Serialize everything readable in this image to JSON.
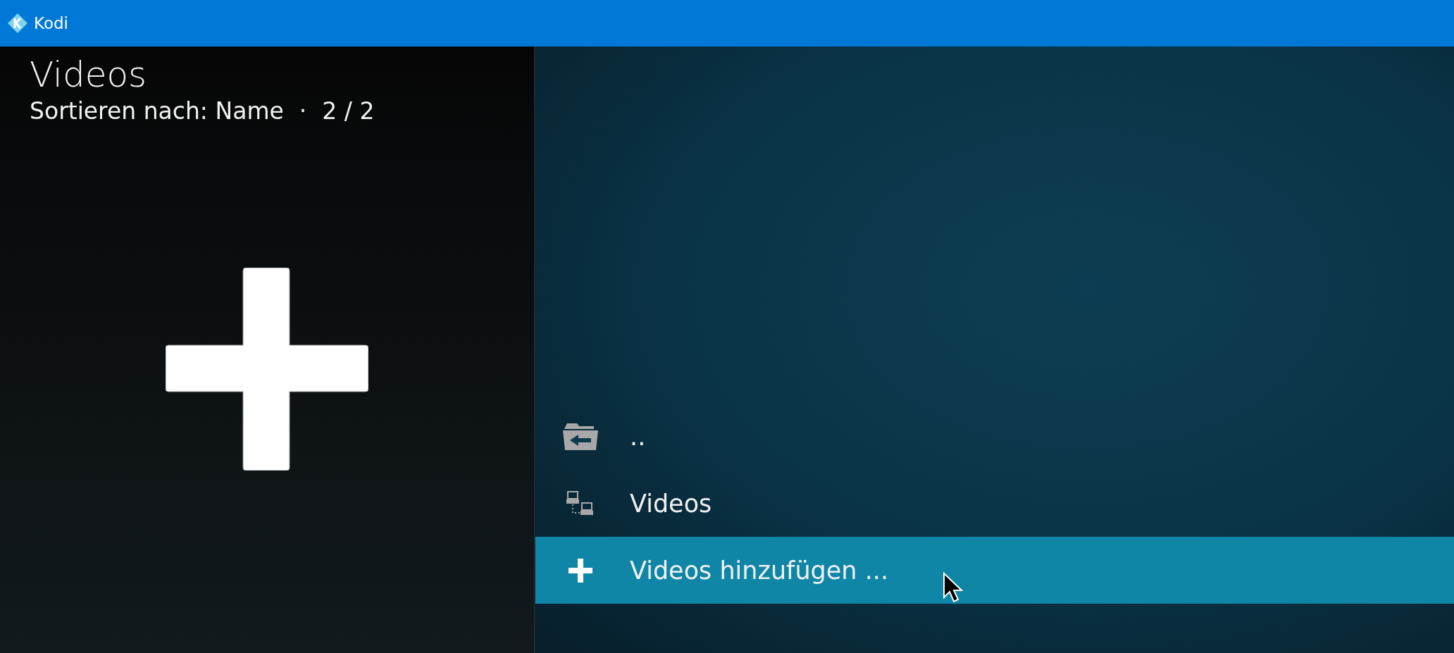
{
  "window": {
    "title": "Kodi"
  },
  "header": {
    "title": "Videos",
    "sort_label": "Sortieren nach: Name",
    "separator": "·",
    "count": "2 / 2"
  },
  "list": {
    "items": [
      {
        "kind": "back",
        "label": "..",
        "selected": false
      },
      {
        "kind": "network",
        "label": "Videos",
        "selected": false
      },
      {
        "kind": "add",
        "label": "Videos hinzufügen ...",
        "selected": true
      }
    ]
  }
}
